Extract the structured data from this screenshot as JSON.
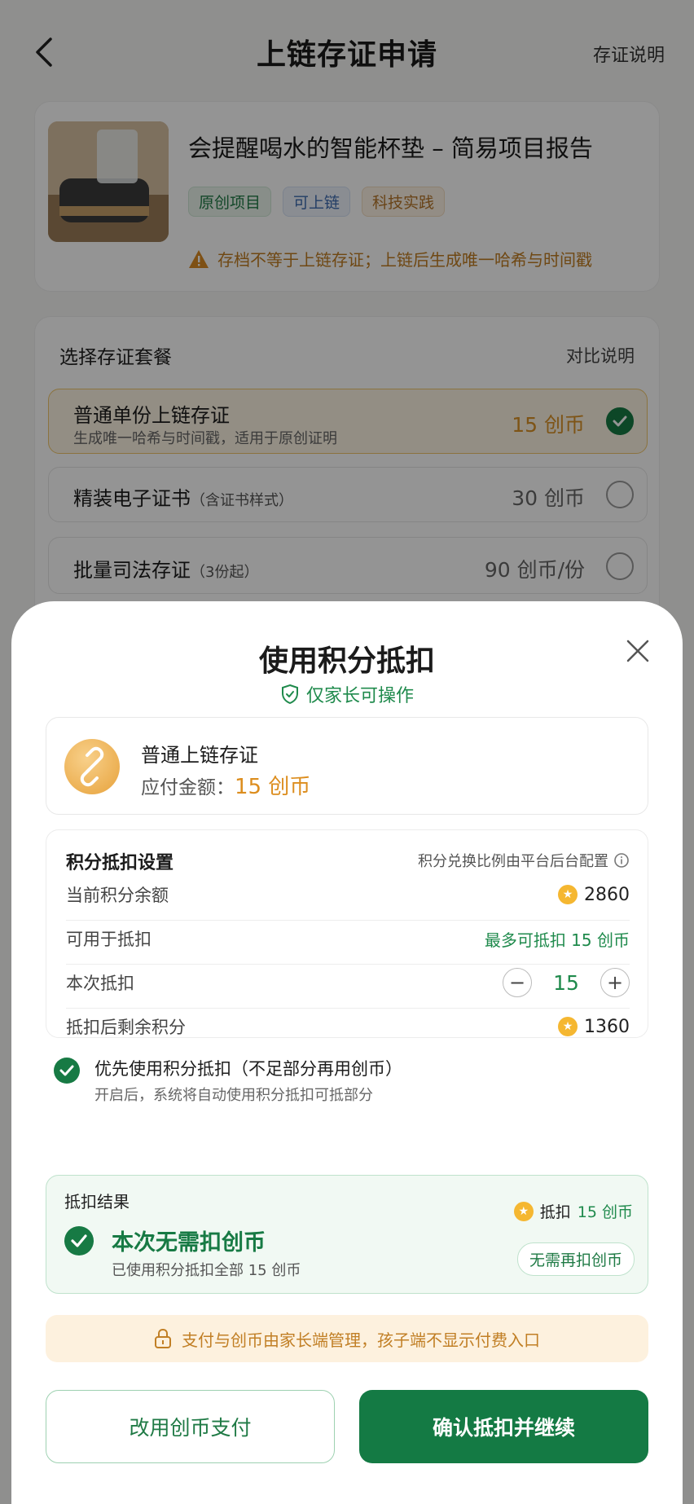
{
  "header": {
    "title": "上链存证申请",
    "help_link": "存证说明"
  },
  "project": {
    "title": "会提醒喝水的智能杯垫 – 简易项目报告",
    "tags": [
      "原创项目",
      "可上链",
      "科技实践"
    ],
    "warning": "存档不等于上链存证；上链后生成唯一哈希与时间戳"
  },
  "packages": {
    "heading": "选择存证套餐",
    "compare_link": "对比说明",
    "options": [
      {
        "name": "普通单份上链存证",
        "note": "",
        "desc": "生成唯一哈希与时间戳，适用于原创证明",
        "price": "15 创币",
        "selected": true
      },
      {
        "name": "精装电子证书",
        "note": "（含证书样式）",
        "desc": "",
        "price": "30 创币",
        "selected": false
      },
      {
        "name": "批量司法存证",
        "note": "（3份起）",
        "desc": "",
        "price": "90 创币/份",
        "selected": false
      }
    ]
  },
  "sheet": {
    "title": "使用积分抵扣",
    "parent_only": "仅家长可操作",
    "item": {
      "name": "普通上链存证",
      "amount_label": "应付金额：",
      "amount_value": "15 创币"
    },
    "settings": {
      "heading": "积分抵扣设置",
      "note": "积分兑换比例由平台后台配置",
      "rows": {
        "balance_label": "当前积分余额",
        "balance_value": "2860",
        "available_label": "可用于抵扣",
        "available_value": "最多可抵扣 15 创币",
        "deduct_label": "本次抵扣",
        "deduct_minus": "−",
        "deduct_value": "15",
        "deduct_plus": "+",
        "remaining_label": "抵扣后剩余积分",
        "remaining_value": "1360"
      }
    },
    "preference": {
      "title": "优先使用积分抵扣（不足部分再用创币）",
      "sub": "开启后，系统将自动使用积分抵扣可抵部分",
      "checked": true
    },
    "result": {
      "heading": "抵扣结果",
      "title": "本次无需扣创币",
      "sub": "已使用积分抵扣全部 15 创币",
      "deduct_prefix": "抵扣",
      "deduct_amount": "15 创币",
      "pill": "无需再扣创币"
    },
    "notice": "支付与创币由家长端管理，孩子端不显示付费入口",
    "buttons": {
      "secondary": "改用创币支付",
      "primary": "确认抵扣并继续"
    }
  },
  "colors": {
    "primary_green": "#147a44",
    "accent_orange": "#dc8d1e",
    "overlay": "rgba(0,0,0,0.42)"
  }
}
